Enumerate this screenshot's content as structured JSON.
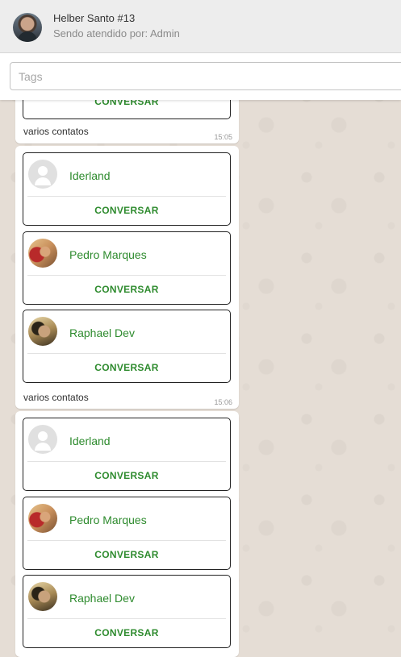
{
  "header": {
    "contact_name": "Helber Santo #13",
    "subtitle": "Sendo atendido por: Admin"
  },
  "tags": {
    "placeholder": "Tags"
  },
  "conversar_label": "CONVERSAR",
  "messages": [
    {
      "caption": "varios contatos",
      "time": "15:05"
    },
    {
      "contacts": [
        {
          "name": "Iderland",
          "avatar": "default-avatar-icon"
        },
        {
          "name": "Pedro Marques",
          "avatar": "photo"
        },
        {
          "name": "Raphael Dev",
          "avatar": "photo"
        }
      ],
      "caption": "varios contatos",
      "time": "15:06"
    },
    {
      "contacts": [
        {
          "name": "Iderland",
          "avatar": "default-avatar-icon"
        },
        {
          "name": "Pedro Marques",
          "avatar": "photo"
        },
        {
          "name": "Raphael Dev",
          "avatar": "photo"
        }
      ]
    }
  ],
  "colors": {
    "accent_green": "#2e8b2e",
    "chat_background": "#e5ddd5",
    "header_background": "#ededed"
  }
}
